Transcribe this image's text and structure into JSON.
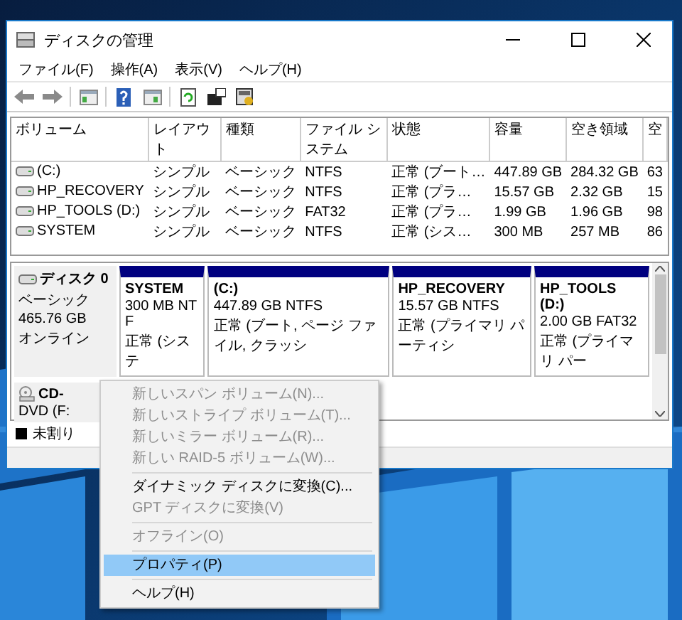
{
  "window": {
    "title": "ディスクの管理"
  },
  "menu": [
    "ファイル(F)",
    "操作(A)",
    "表示(V)",
    "ヘルプ(H)"
  ],
  "volume_table": {
    "columns": [
      "ボリューム",
      "レイアウト",
      "種類",
      "ファイル システム",
      "状態",
      "容量",
      "空き領域",
      "空"
    ],
    "rows": [
      {
        "cells": [
          "(C:)",
          "シンプル",
          "ベーシック",
          "NTFS",
          "正常 (ブート…",
          "447.89 GB",
          "284.32 GB",
          "63"
        ]
      },
      {
        "cells": [
          "HP_RECOVERY",
          "シンプル",
          "ベーシック",
          "NTFS",
          "正常 (プラ…",
          "15.57 GB",
          "2.32 GB",
          "15"
        ]
      },
      {
        "cells": [
          "HP_TOOLS (D:)",
          "シンプル",
          "ベーシック",
          "FAT32",
          "正常 (プラ…",
          "1.99 GB",
          "1.96 GB",
          "98"
        ]
      },
      {
        "cells": [
          "SYSTEM",
          "シンプル",
          "ベーシック",
          "NTFS",
          "正常 (シス…",
          "300 MB",
          "257 MB",
          "86"
        ]
      }
    ]
  },
  "disks": [
    {
      "kind": "disk",
      "name": "ディスク 0",
      "lines": [
        "ベーシック",
        "465.76 GB",
        "オンライン"
      ],
      "partitions": [
        {
          "name": "SYSTEM",
          "size": "300 MB NTF",
          "status": "正常 (システ"
        },
        {
          "name": "(C:)",
          "size": "447.89 GB NTFS",
          "status": "正常 (ブート, ページ ファイル, クラッシ"
        },
        {
          "name": "HP_RECOVERY",
          "size": "15.57 GB NTFS",
          "status": "正常 (プライマリ パーティシ"
        },
        {
          "name": "HP_TOOLS (D:)",
          "size": "2.00 GB FAT32",
          "status": "正常 (プライマリ パー"
        }
      ]
    },
    {
      "kind": "cdrom",
      "name": "CD-",
      "lines": [
        "DVD (F:"
      ]
    }
  ],
  "legend": [
    {
      "label": "未割り",
      "color": "#000000"
    }
  ],
  "context_menu": {
    "items": [
      {
        "kind": "item",
        "label": "新しいスパン ボリューム(N)...",
        "disabled": true,
        "selected": false
      },
      {
        "kind": "item",
        "label": "新しいストライプ ボリューム(T)...",
        "disabled": true,
        "selected": false
      },
      {
        "kind": "item",
        "label": "新しいミラー ボリューム(R)...",
        "disabled": true,
        "selected": false
      },
      {
        "kind": "item",
        "label": "新しい RAID-5 ボリューム(W)...",
        "disabled": true,
        "selected": false
      },
      {
        "kind": "separator"
      },
      {
        "kind": "item",
        "label": "ダイナミック ディスクに変換(C)...",
        "disabled": false,
        "selected": false
      },
      {
        "kind": "item",
        "label": "GPT ディスクに変換(V)",
        "disabled": true,
        "selected": false
      },
      {
        "kind": "separator"
      },
      {
        "kind": "item",
        "label": "オフライン(O)",
        "disabled": true,
        "selected": false
      },
      {
        "kind": "separator"
      },
      {
        "kind": "item",
        "label": "プロパティ(P)",
        "disabled": false,
        "selected": true
      },
      {
        "kind": "separator"
      },
      {
        "kind": "item",
        "label": "ヘルプ(H)",
        "disabled": false,
        "selected": false
      }
    ]
  }
}
